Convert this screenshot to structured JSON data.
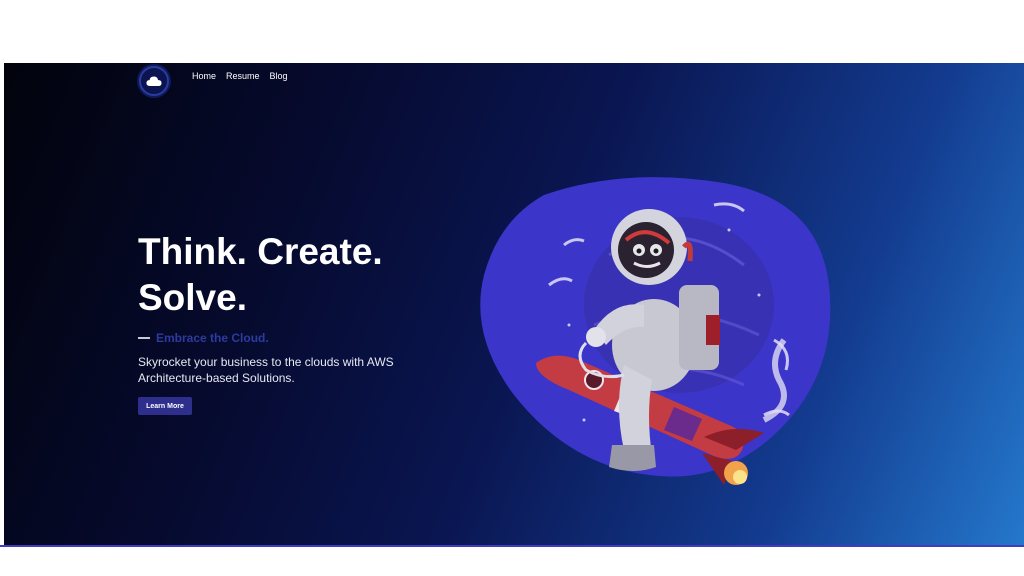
{
  "nav": {
    "logo_icon": "cloud-icon",
    "items": [
      {
        "label": "Home"
      },
      {
        "label": "Resume"
      },
      {
        "label": "Blog"
      }
    ]
  },
  "hero": {
    "headline_line1": "Think. Create.",
    "headline_line2": "Solve.",
    "tagline": "Embrace the Cloud.",
    "description": "Skyrocket your business to the clouds with AWS Architecture-based Solutions.",
    "cta_label": "Learn More",
    "illustration_icon": "astronaut-rocket-icon"
  },
  "colors": {
    "accent": "#2e2f8c",
    "tagline": "#2d3b9e",
    "blob": "#3b35c9",
    "hero_dark": "#02030c",
    "hero_light": "#2478cc"
  }
}
